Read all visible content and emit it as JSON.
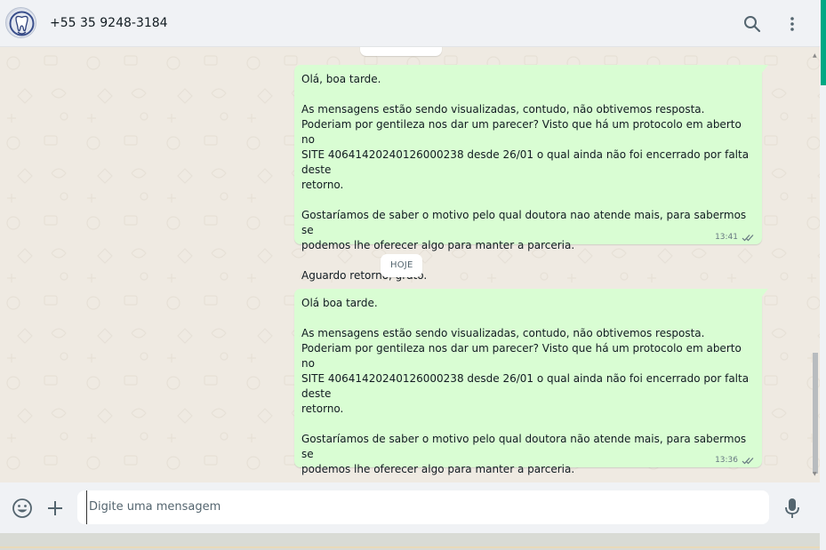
{
  "header": {
    "contact_name": "+55 35 9248-3184",
    "avatar_icon": "tooth-logo-icon",
    "search_icon": "search-icon",
    "menu_icon": "kebab-menu-icon"
  },
  "chat": {
    "date_separator": "HOJE",
    "messages": [
      {
        "text": "Olá, boa tarde.\n\nAs mensagens estão sendo visualizadas, contudo, não obtivemos resposta.\nPoderiam por gentileza nos dar um parecer? Visto que há um protocolo em aberto no\nSITE 40641420240126000238 desde 26/01 o qual ainda não foi encerrado por falta deste\nretorno.\n\nGostaríamos de saber o motivo pelo qual doutora nao atende mais, para sabermos se\npodemos lhe oferecer algo para manter a parceria.\n\nAguardo retorno, grato.",
        "time": "13:41",
        "status": "read"
      },
      {
        "text": "Olá boa tarde.\n\nAs mensagens estão sendo visualizadas, contudo, não obtivemos resposta.\nPoderiam por gentileza nos dar um parecer? Visto que há um protocolo em aberto no\nSITE 40641420240126000238 desde 26/01 o qual ainda não foi encerrado por falta deste\nretorno.\n\nGostaríamos de saber o motivo pelo qual doutora não atende mais, para sabermos se\npodemos lhe oferecer algo para manter a parceria.\n\nAguardo retorno, grata.",
        "time": "13:36",
        "status": "read"
      }
    ]
  },
  "composer": {
    "placeholder": "Digite uma mensagem",
    "value": "",
    "emoji_icon": "emoji-icon",
    "attach_icon": "plus-icon",
    "mic_icon": "microphone-icon"
  },
  "colors": {
    "outgoing_bubble": "#d9fdd3",
    "chat_background": "#efeae2",
    "header_background": "#f0f2f5",
    "accent": "#00a884",
    "read_ticks": "#667781"
  }
}
